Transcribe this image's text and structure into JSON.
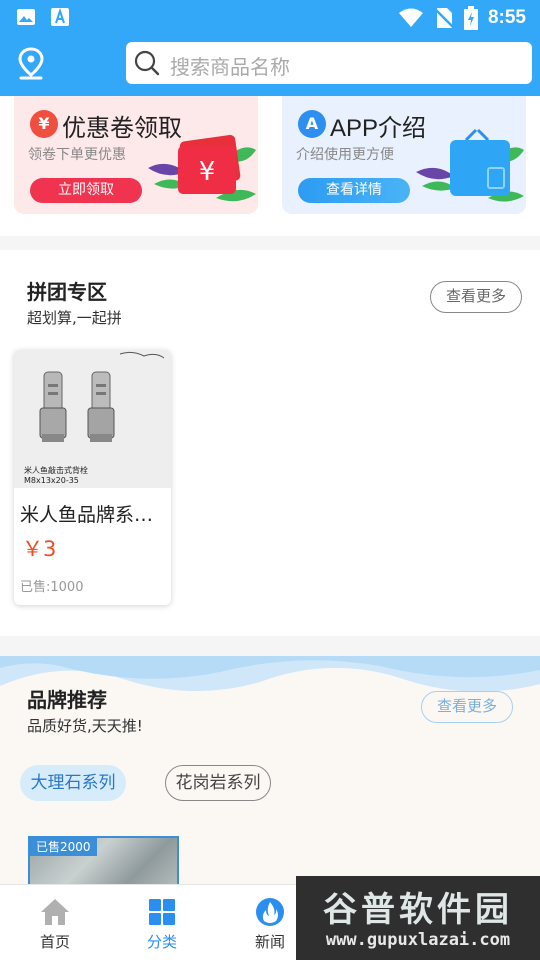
{
  "status_bar": {
    "time": "8:55",
    "icons": [
      "image-icon",
      "a-text-icon",
      "wifi-icon",
      "no-sim-icon",
      "battery-icon"
    ]
  },
  "header": {
    "search_placeholder": "搜索商品名称",
    "icons": [
      "location-pin-icon",
      "search-icon"
    ]
  },
  "promos": [
    {
      "badge": "¥",
      "title": "优惠卷领取",
      "subtitle": "领卷下单更优惠",
      "button": "立即领取",
      "icon": "coupon-icon"
    },
    {
      "badge": "A",
      "title": "APP介绍",
      "subtitle": "介绍使用更方便",
      "button": "查看详情",
      "icon": "shopping-bag-icon"
    }
  ],
  "coupon_art_symbol": "¥",
  "group_buy": {
    "title": "拼团专区",
    "subtitle": "超划算,一起拼",
    "more": "查看更多",
    "products": [
      {
        "image_caption_line1": "米人鱼敲击式背栓",
        "image_caption_line2": "M8x13x20-35",
        "name": "米人鱼品牌系列背栓",
        "price": "￥3",
        "sold": "已售:1000"
      }
    ]
  },
  "brand": {
    "title": "品牌推荐",
    "subtitle": "品质好货,天天推!",
    "more": "查看更多",
    "tags": [
      "大理石系列",
      "花岗岩系列"
    ],
    "tile_flag": "已售2000"
  },
  "nav": [
    {
      "label": "首页",
      "icon": "home-icon",
      "active": false
    },
    {
      "label": "分类",
      "icon": "grid-icon",
      "active": true
    },
    {
      "label": "新闻",
      "icon": "flame-icon",
      "active": false
    }
  ],
  "watermark": {
    "text": "谷普软件园",
    "url": "www.gupuxlazai.com"
  },
  "colors": {
    "primary": "#33a8f8",
    "accent_red": "#f0344f",
    "price": "#f04e1e"
  }
}
